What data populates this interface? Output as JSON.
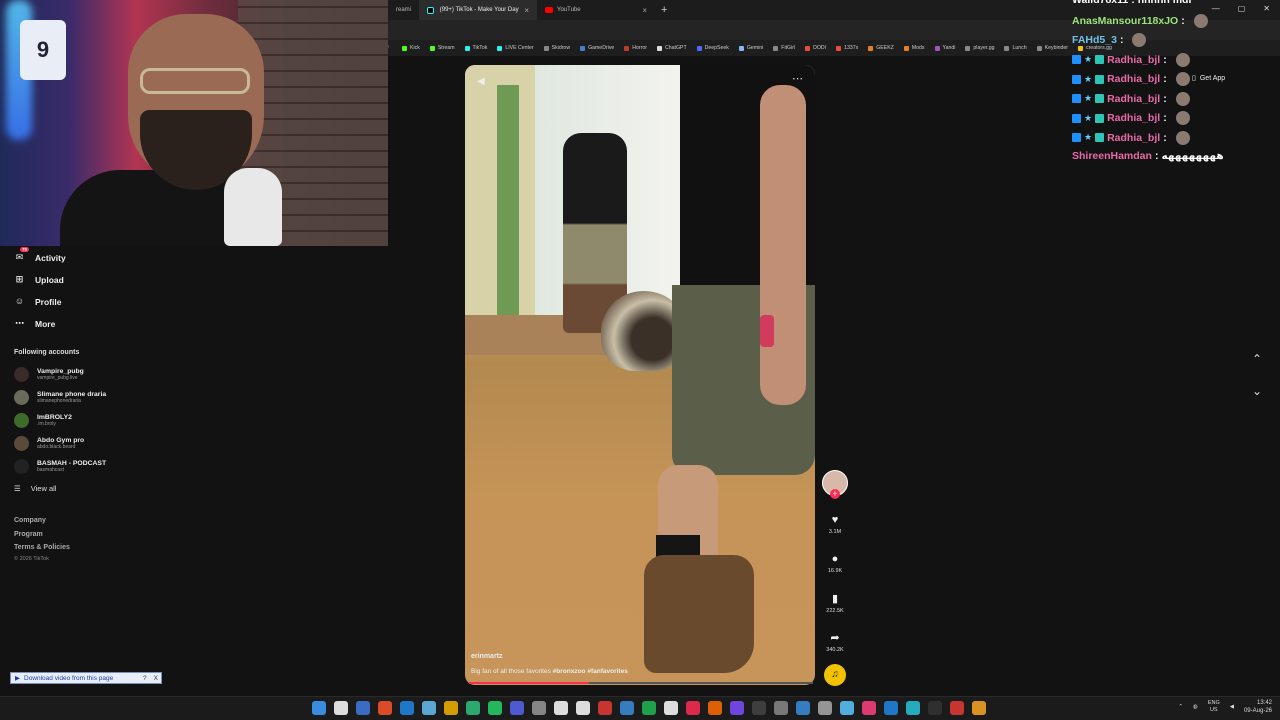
{
  "browser": {
    "tabs": [
      {
        "label": "reami"
      },
      {
        "label": "(99+) TikTok - Make Your Day",
        "active": true
      },
      {
        "label": "YouTube"
      }
    ],
    "new_tab": "+",
    "bookmarks_left": "p",
    "bookmarks": [
      {
        "label": "Kick",
        "color": "#53fc18"
      },
      {
        "label": "Stream",
        "color": "#53fc18"
      },
      {
        "label": "TikTok",
        "color": "#25f4ee"
      },
      {
        "label": "LIVE Center",
        "color": "#25f4ee"
      },
      {
        "label": "Skidrow",
        "color": "#888888"
      },
      {
        "label": "GameDrive",
        "color": "#4a7bd0"
      },
      {
        "label": "Horror",
        "color": "#c0392b"
      },
      {
        "label": "ChatGPT",
        "color": "#dddddd"
      },
      {
        "label": "DeepSeek",
        "color": "#4d6bfe"
      },
      {
        "label": "Gemini",
        "color": "#8ab4f8"
      },
      {
        "label": "FitGirl",
        "color": "#888888"
      },
      {
        "label": "DODI",
        "color": "#e74c3c"
      },
      {
        "label": "1337x",
        "color": "#e74c3c"
      },
      {
        "label": "GEEKZ",
        "color": "#e67e22"
      },
      {
        "label": "Mods",
        "color": "#e67e22"
      },
      {
        "label": "Yandi",
        "color": "#9b59b6"
      },
      {
        "label": "player.gg",
        "color": "#888888"
      },
      {
        "label": "Lunch",
        "color": "#888888"
      },
      {
        "label": "Keybinder",
        "color": "#888888"
      },
      {
        "label": "creators.gg",
        "color": "#f1c40f"
      }
    ]
  },
  "sidebar": {
    "nav": [
      {
        "label": "Activity",
        "icon": "bell-icon",
        "glyph": "✉",
        "badge": "79"
      },
      {
        "label": "Upload",
        "icon": "upload-icon",
        "glyph": "⊞"
      },
      {
        "label": "Profile",
        "icon": "profile-icon",
        "glyph": "☺"
      },
      {
        "label": "More",
        "icon": "more-icon",
        "glyph": "⋯"
      }
    ],
    "following_title": "Following accounts",
    "accounts": [
      {
        "name": "Vampire_pubg",
        "handle": "vampire_pubg.live"
      },
      {
        "name": "Slimane phone draria",
        "handle": "slimanephonedraria"
      },
      {
        "name": "ImBROLY2",
        "handle": ".im.broly"
      },
      {
        "name": "Abdo Gym pro",
        "handle": "abdo.black.beard"
      },
      {
        "name": "BASMAH - PODCAST",
        "handle": "basmahcast"
      }
    ],
    "view_all": "View all",
    "footer": [
      "Company",
      "Program",
      "Terms & Policies"
    ],
    "copyright": "© 2026 TikTok"
  },
  "download_bar": {
    "label": "Download video from this page",
    "help": "?",
    "close": "X"
  },
  "video": {
    "author": "erinmartz",
    "caption_text": "Big fan of all those favorites ",
    "hashtags": [
      "#bronxzoo",
      "#fanfavorites"
    ],
    "progress": 0.35
  },
  "actions": {
    "likes": "3.1M",
    "comments": "16.9K",
    "saves": "222.5K",
    "shares": "340.2K"
  },
  "chat": {
    "lines": [
      {
        "user": "Walid78x11",
        "color": "#ffffff",
        "msg": "hhhhh mdr",
        "badges": false
      },
      {
        "user": "AnasMansour118xJO",
        "color": "#9be37a",
        "msg": "",
        "badges": false,
        "emote": true
      },
      {
        "user": "FAHd5_3",
        "color": "#6ec1e4",
        "msg": "",
        "badges": false,
        "emote": true
      },
      {
        "user": "Radhia_bjl",
        "color": "#e86aa8",
        "msg": "",
        "badges": true,
        "emote": true
      },
      {
        "user": "Radhia_bjl",
        "color": "#e86aa8",
        "msg": "",
        "badges": true,
        "emote": true
      },
      {
        "user": "Radhia_bjl",
        "color": "#e86aa8",
        "msg": "",
        "badges": true,
        "emote": true
      },
      {
        "user": "Radhia_bjl",
        "color": "#e86aa8",
        "msg": "",
        "badges": true,
        "emote": true
      },
      {
        "user": "Radhia_bjl",
        "color": "#e86aa8",
        "msg": "",
        "badges": true,
        "emote": true
      },
      {
        "user": "ShireenHamdan",
        "color": "#e86aa8",
        "msg": "ههههههههه",
        "badges": false
      }
    ],
    "get_app": "Get App"
  },
  "taskbar": {
    "lang": "ENG",
    "region": "US",
    "time": "13:42",
    "date": "09-Aug-26",
    "icon_colors": [
      "#3a8dde",
      "#ffffff",
      "#3f7ae0",
      "#fb542b",
      "#1e88e5",
      "#66c0f4",
      "#f4b400",
      "#2ec27e",
      "#25d366",
      "#5865f2",
      "#999999",
      "#ffffff",
      "#ffffff",
      "#e53935",
      "#3a8dde",
      "#1db954",
      "#ffffff",
      "#fe2c55",
      "#ff6d00",
      "#7c4dff",
      "#444444",
      "#888888",
      "#3a8dde",
      "#aaaaaa",
      "#5cc8ff",
      "#ff4081",
      "#1e88e5",
      "#26c6da",
      "#333333",
      "#e53935",
      "#f9a825"
    ]
  }
}
